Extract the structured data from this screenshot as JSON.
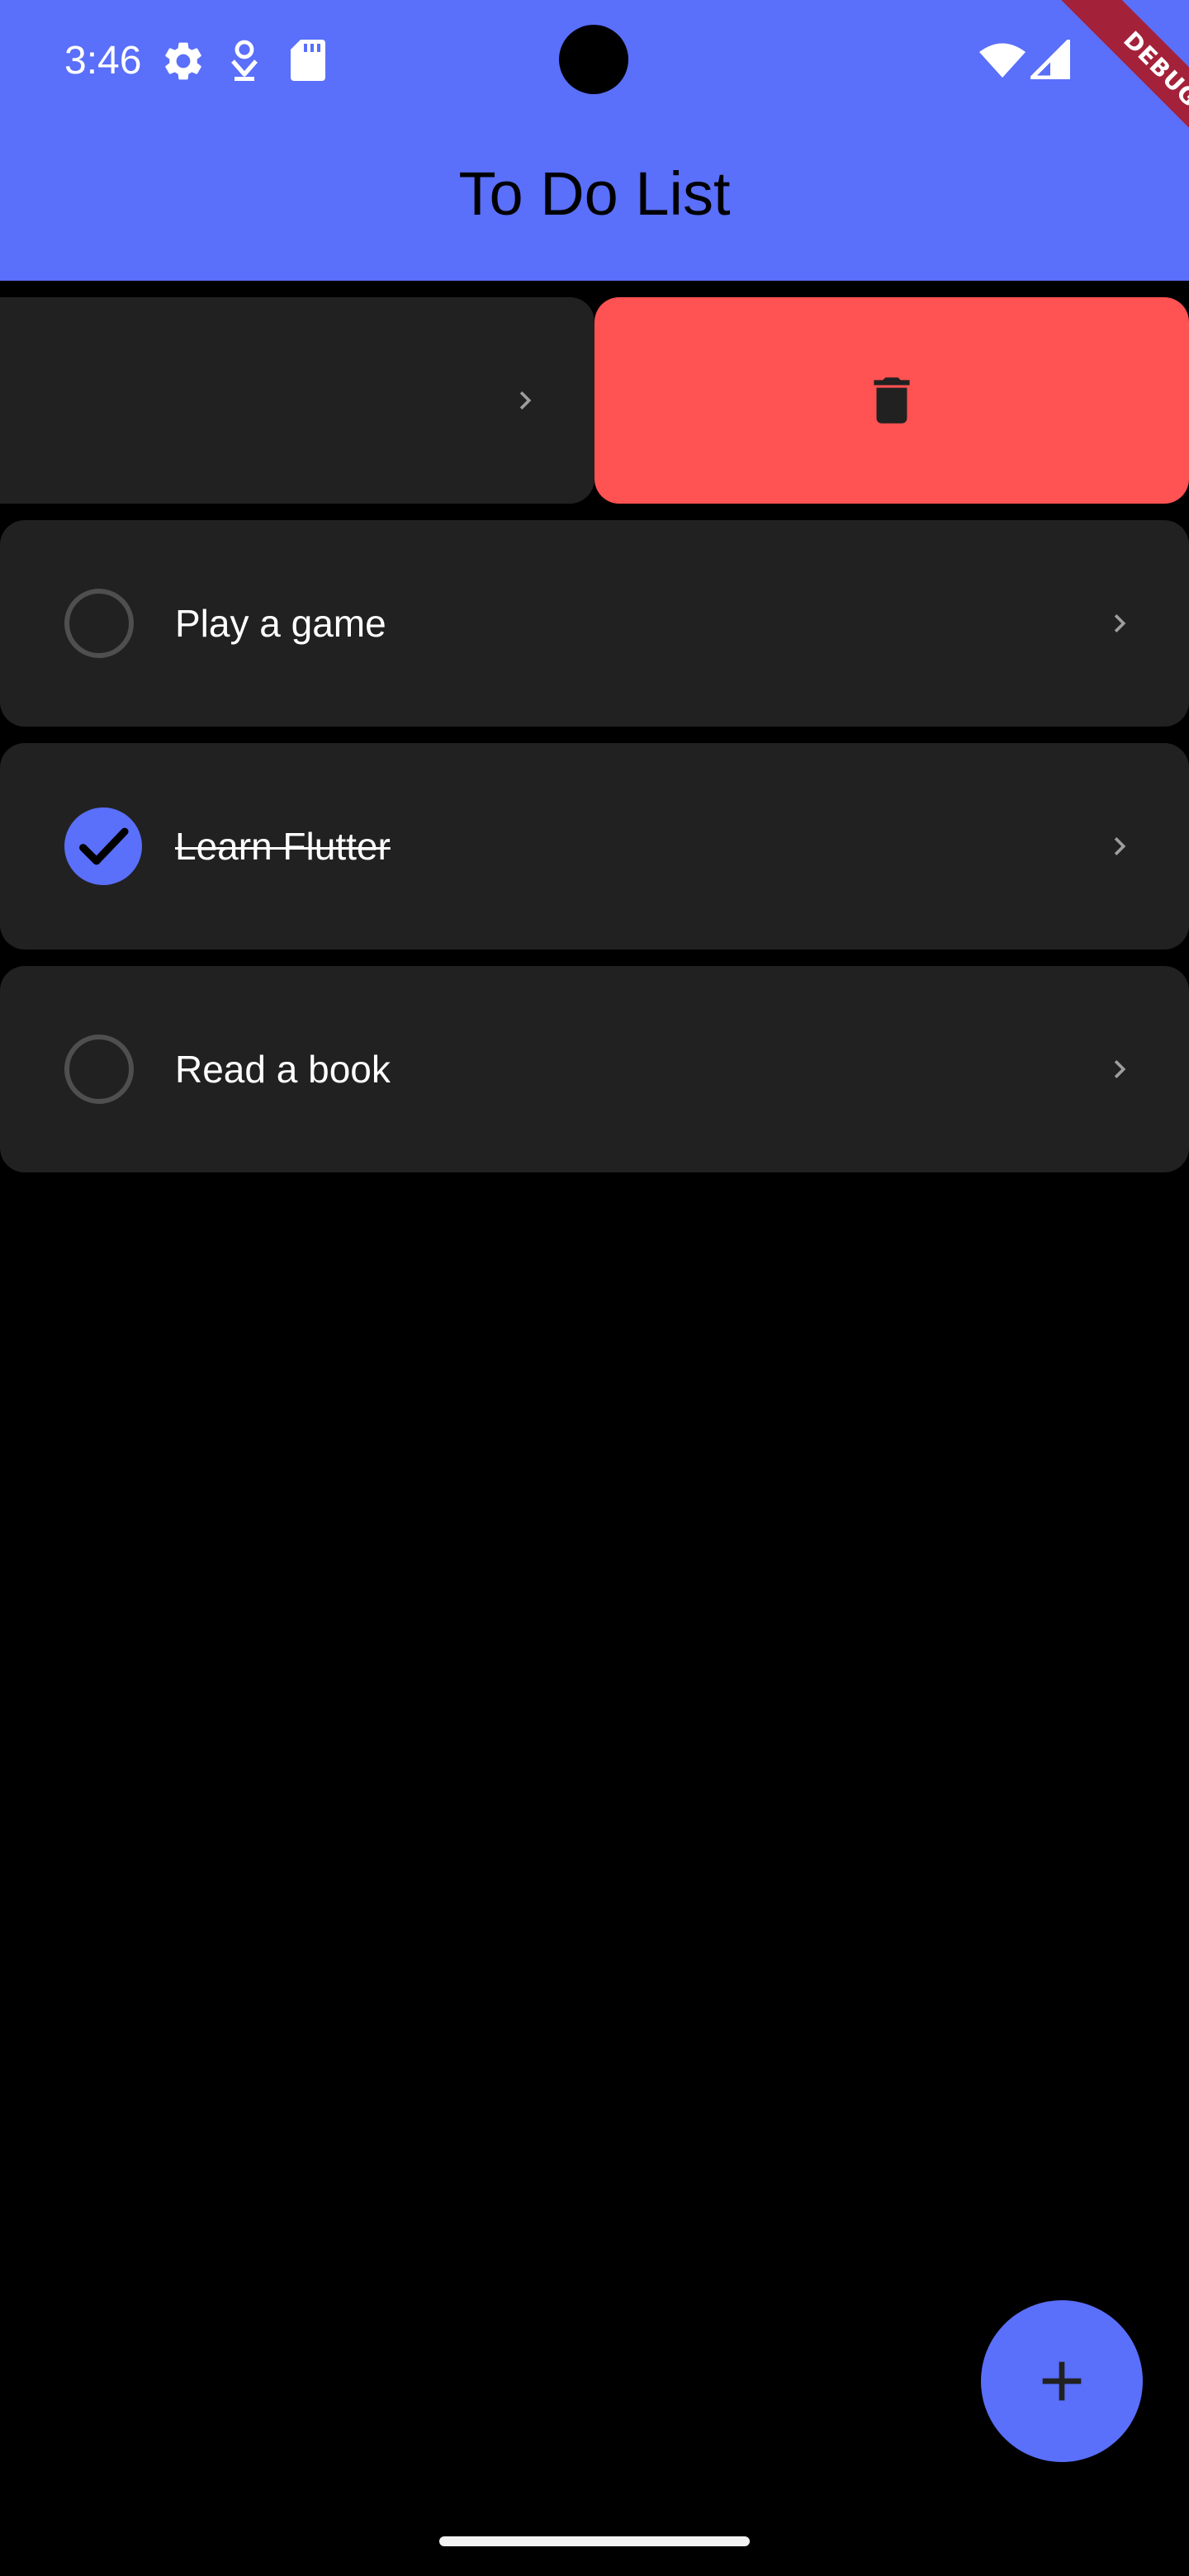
{
  "status_bar": {
    "time": "3:46",
    "icons": [
      "settings-icon",
      "notification-icon",
      "sd-card-icon",
      "wifi-icon",
      "signal-icon"
    ]
  },
  "debug_banner": "DEBUG",
  "app_bar": {
    "title": "To Do List",
    "color": "#5a6ffa"
  },
  "swiped_item": {
    "label": "",
    "action_icon": "trash-icon",
    "action_color": "#ff5252"
  },
  "todos": [
    {
      "label": "Play a game",
      "done": false
    },
    {
      "label": "Learn Flutter",
      "done": true
    },
    {
      "label": "Read a book",
      "done": false
    }
  ],
  "fab": {
    "icon": "plus-icon"
  }
}
